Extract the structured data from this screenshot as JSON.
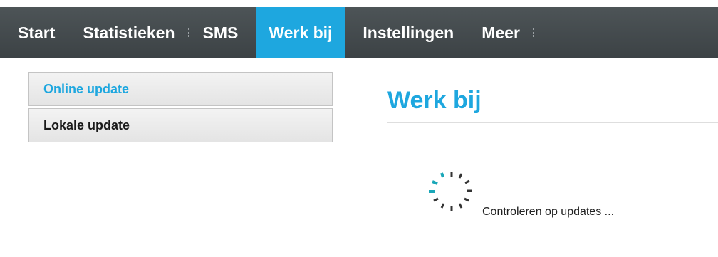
{
  "nav": {
    "items": [
      {
        "label": "Start",
        "active": false
      },
      {
        "label": "Statistieken",
        "active": false
      },
      {
        "label": "SMS",
        "active": false
      },
      {
        "label": "Werk bij",
        "active": true
      },
      {
        "label": "Instellingen",
        "active": false
      },
      {
        "label": "Meer",
        "active": false
      }
    ]
  },
  "sidebar": {
    "items": [
      {
        "label": "Online update",
        "selected": true
      },
      {
        "label": "Lokale update",
        "selected": false
      }
    ]
  },
  "main": {
    "title": "Werk bij",
    "status_text": "Controleren op updates ..."
  },
  "colors": {
    "accent": "#1ea7df",
    "nav_bg": "#44494c",
    "spinner_active": "#1aa7b8",
    "spinner_idle": "#333333"
  },
  "icons": {
    "spinner": "loading-spinner-icon"
  }
}
